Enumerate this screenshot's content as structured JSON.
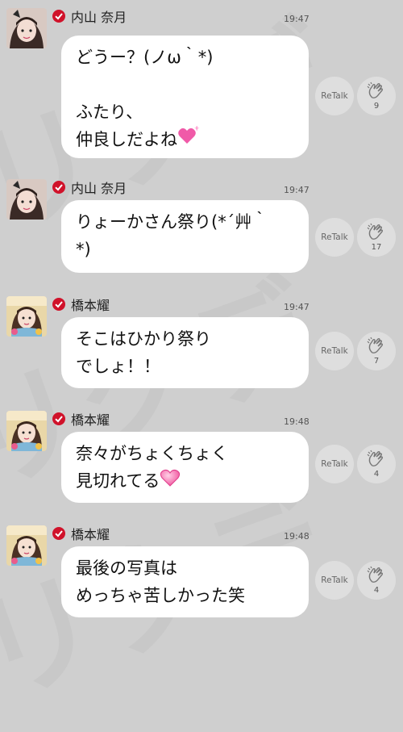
{
  "watermark": "リクデ",
  "messages": [
    {
      "name": "内山 奈月",
      "time": "19:47",
      "text": "どうー？(ノω｀*)\n\nふたり、\n仲良しだよね",
      "heart": "sparkle",
      "retalk": "ReTalk",
      "claps": "9",
      "avatar": "uchiyama"
    },
    {
      "name": "内山 奈月",
      "time": "19:47",
      "text": "りょーかさん祭り(*´艸｀\n*)",
      "retalk": "ReTalk",
      "claps": "17",
      "avatar": "uchiyama"
    },
    {
      "name": "橋本耀",
      "time": "19:47",
      "text": "そこはひかり祭り\nでしょ！！",
      "retalk": "ReTalk",
      "claps": "7",
      "avatar": "hashimoto"
    },
    {
      "name": "橋本耀",
      "time": "19:48",
      "text": "奈々がちょくちょく\n見切れてる",
      "heart": "pink",
      "retalk": "ReTalk",
      "claps": "4",
      "avatar": "hashimoto"
    },
    {
      "name": "橋本耀",
      "time": "19:48",
      "text": "最後の写真は\nめっちゃ苦しかった笑",
      "retalk": "ReTalk",
      "claps": "4",
      "avatar": "hashimoto"
    }
  ],
  "colors": {
    "background": "#cfcfcf",
    "bubble": "#ffffff",
    "verified": "#d0122a",
    "heart": "#f05aa8"
  },
  "icons": {
    "verified": "check-badge-icon",
    "clap": "clapping-hands-icon"
  }
}
